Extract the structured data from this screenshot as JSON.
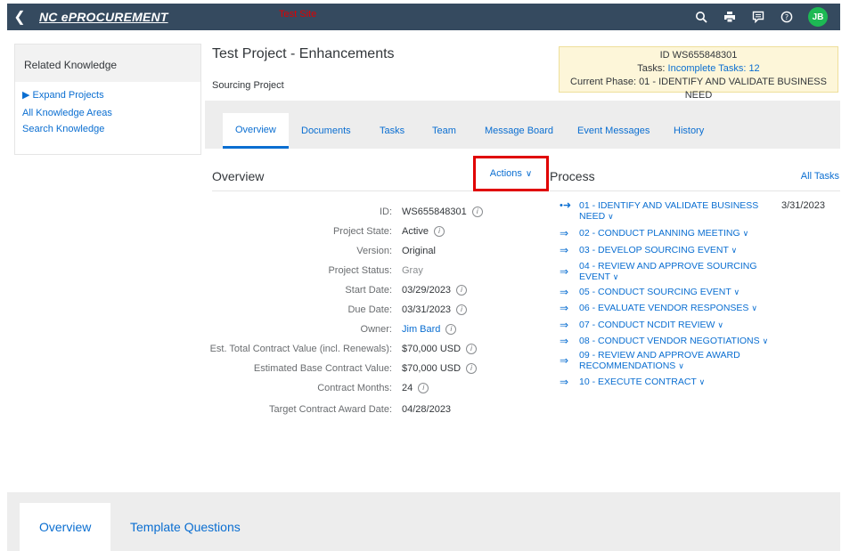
{
  "topbar": {
    "back_icon": "chevron-left-icon",
    "brand": "NC ePROCUREMENT",
    "test_site": "Test Site",
    "icons": [
      "search-icon",
      "print-icon",
      "feedback-icon",
      "help-icon"
    ],
    "avatar_initials": "JB",
    "avatar_color": "#1db954"
  },
  "related_knowledge": {
    "title": "Related Knowledge",
    "links": [
      "▶ Expand Projects",
      "All Knowledge Areas",
      "Search Knowledge"
    ]
  },
  "project": {
    "title": "Test Project - Enhancements",
    "subtitle": "Sourcing Project",
    "id_line": "ID WS655848301",
    "tasks_label": "Tasks:",
    "tasks_link": "Incomplete Tasks: 12",
    "phase_line": "Current Phase: 01 - IDENTIFY AND VALIDATE BUSINESS NEED"
  },
  "tabs": [
    "Overview",
    "Documents",
    "Tasks",
    "Team",
    "Message Board",
    "Event Messages",
    "History"
  ],
  "overview": {
    "title": "Overview",
    "actions_label": "Actions",
    "fields": [
      {
        "label": "ID:",
        "value": "WS655848301",
        "info": true
      },
      {
        "label": "Project State:",
        "value": "Active",
        "info": true
      },
      {
        "label": "Version:",
        "value": "Original",
        "info": false
      },
      {
        "label": "Project Status:",
        "value": "Gray",
        "info": false
      },
      {
        "label": "Start Date:",
        "value": "03/29/2023",
        "info": true
      },
      {
        "label": "Due Date:",
        "value": "03/31/2023",
        "info": true
      },
      {
        "label": "Owner:",
        "value": "Jim Bard",
        "info": true
      },
      {
        "label": "Est. Total Contract Value (incl. Renewals):",
        "value": "$70,000 USD",
        "info": true
      },
      {
        "label": "Estimated Base Contract Value:",
        "value": "$70,000 USD",
        "info": true
      },
      {
        "label": "Contract Months:",
        "value": "24",
        "info": true
      },
      {
        "label": "Target Contract Award Date:",
        "value": "04/28/2023",
        "info": false
      }
    ]
  },
  "process": {
    "title": "Process",
    "all_tasks": "All Tasks",
    "current_date": "3/31/2023",
    "steps": [
      "01 - IDENTIFY AND VALIDATE BUSINESS NEED",
      "02 - CONDUCT PLANNING MEETING",
      "03 - DEVELOP SOURCING EVENT",
      "04 - REVIEW AND APPROVE SOURCING EVENT",
      "05 - CONDUCT SOURCING EVENT",
      "06 - EVALUATE VENDOR RESPONSES",
      "07 - CONDUCT NCDIT REVIEW",
      "08 - CONDUCT VENDOR NEGOTIATIONS",
      "09 - REVIEW AND APPROVE AWARD RECOMMENDATIONS",
      "10 - EXECUTE CONTRACT"
    ]
  },
  "bottom_tabs": [
    "Overview",
    "Template Questions"
  ],
  "colors": {
    "shell": "#354a5f",
    "link": "#0a6ed1",
    "highlight": "#e00000",
    "id_box_bg": "#fdf6d9"
  }
}
